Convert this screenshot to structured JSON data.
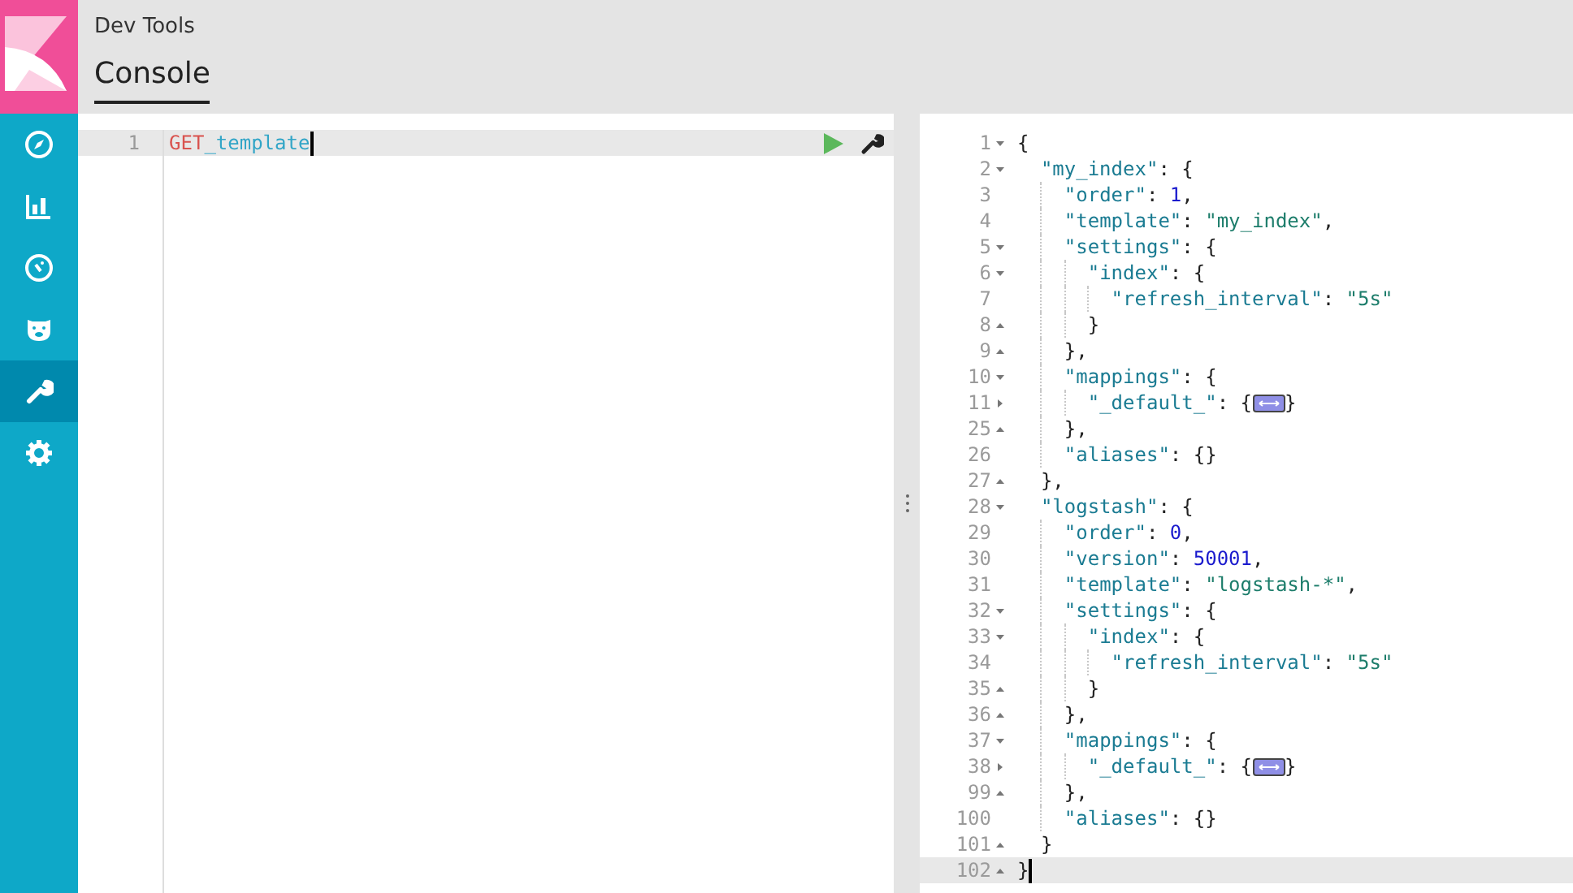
{
  "app": {
    "title": "Dev Tools"
  },
  "nav": [
    {
      "kind": "compass",
      "selected": false
    },
    {
      "kind": "chart",
      "selected": false
    },
    {
      "kind": "gauge",
      "selected": false
    },
    {
      "kind": "bear",
      "selected": false
    },
    {
      "kind": "wrench",
      "selected": true
    },
    {
      "kind": "gear",
      "selected": false
    }
  ],
  "tabs": [
    {
      "label": "Console",
      "selected": true
    }
  ],
  "request": {
    "lines": [
      {
        "number": "1",
        "active": true,
        "tokens": [
          {
            "kind": "method",
            "text": "GET"
          },
          {
            "kind": "url",
            "text": "_template"
          }
        ]
      }
    ]
  },
  "response": {
    "lines": [
      {
        "number": "1",
        "kind": "opener",
        "active": false,
        "tokens": [
          {
            "kind": "punct",
            "text": "{"
          }
        ],
        "children": [
          {
            "number": "2",
            "kind": "opener",
            "active": false,
            "tokens": [
              {
                "kind": "key",
                "text": "\"my_index\""
              },
              {
                "kind": "punct",
                "text": ": {"
              }
            ],
            "children": [
              {
                "number": "3",
                "active": false,
                "tokens": [
                  {
                    "kind": "key",
                    "text": "\"order\""
                  },
                  {
                    "kind": "punct",
                    "text": ": "
                  },
                  {
                    "kind": "number",
                    "text": "1"
                  },
                  {
                    "kind": "punct",
                    "text": ","
                  }
                ]
              },
              {
                "number": "4",
                "active": false,
                "tokens": [
                  {
                    "kind": "key",
                    "text": "\"template\""
                  },
                  {
                    "kind": "punct",
                    "text": ": "
                  },
                  {
                    "kind": "string",
                    "text": "\"my_index\""
                  },
                  {
                    "kind": "punct",
                    "text": ","
                  }
                ]
              },
              {
                "number": "5",
                "kind": "opener",
                "active": false,
                "tokens": [
                  {
                    "kind": "key",
                    "text": "\"settings\""
                  },
                  {
                    "kind": "punct",
                    "text": ": {"
                  }
                ],
                "children": [
                  {
                    "number": "6",
                    "kind": "opener",
                    "active": false,
                    "tokens": [
                      {
                        "kind": "key",
                        "text": "\"index\""
                      },
                      {
                        "kind": "punct",
                        "text": ": {"
                      }
                    ],
                    "children": [
                      {
                        "number": "7",
                        "active": false,
                        "tokens": [
                          {
                            "kind": "key",
                            "text": "\"refresh_interval\""
                          },
                          {
                            "kind": "punct",
                            "text": ": "
                          },
                          {
                            "kind": "string",
                            "text": "\"5s\""
                          }
                        ]
                      }
                    ]
                  },
                  {
                    "number": "8",
                    "kind": "closer",
                    "active": false,
                    "tokens": [
                      {
                        "kind": "punct",
                        "text": "}"
                      }
                    ]
                  }
                ]
              },
              {
                "number": "9",
                "kind": "closer",
                "active": false,
                "tokens": [
                  {
                    "kind": "punct",
                    "text": "},"
                  }
                ]
              },
              {
                "number": "10",
                "kind": "opener",
                "active": false,
                "tokens": [
                  {
                    "kind": "key",
                    "text": "\"mappings\""
                  },
                  {
                    "kind": "punct",
                    "text": ": {"
                  }
                ],
                "children": [
                  {
                    "number": "11",
                    "kind": "collapsed",
                    "active": false,
                    "tokens": [
                      {
                        "kind": "key",
                        "text": "\"_default_\""
                      },
                      {
                        "kind": "punct",
                        "text": ": {"
                      },
                      {
                        "kind": "folded"
                      },
                      {
                        "kind": "punct",
                        "text": "}"
                      }
                    ]
                  }
                ]
              },
              {
                "number": "25",
                "kind": "closer",
                "active": false,
                "tokens": [
                  {
                    "kind": "punct",
                    "text": "},"
                  }
                ]
              },
              {
                "number": "26",
                "active": false,
                "tokens": [
                  {
                    "kind": "key",
                    "text": "\"aliases\""
                  },
                  {
                    "kind": "punct",
                    "text": ": {}"
                  }
                ]
              }
            ]
          },
          {
            "number": "27",
            "kind": "closer",
            "active": false,
            "tokens": [
              {
                "kind": "punct",
                "text": "},"
              }
            ]
          },
          {
            "number": "28",
            "kind": "opener",
            "active": false,
            "tokens": [
              {
                "kind": "key",
                "text": "\"logstash\""
              },
              {
                "kind": "punct",
                "text": ": {"
              }
            ],
            "children": [
              {
                "number": "29",
                "active": false,
                "tokens": [
                  {
                    "kind": "key",
                    "text": "\"order\""
                  },
                  {
                    "kind": "punct",
                    "text": ": "
                  },
                  {
                    "kind": "number",
                    "text": "0"
                  },
                  {
                    "kind": "punct",
                    "text": ","
                  }
                ]
              },
              {
                "number": "30",
                "active": false,
                "tokens": [
                  {
                    "kind": "key",
                    "text": "\"version\""
                  },
                  {
                    "kind": "punct",
                    "text": ": "
                  },
                  {
                    "kind": "number",
                    "text": "50001"
                  },
                  {
                    "kind": "punct",
                    "text": ","
                  }
                ]
              },
              {
                "number": "31",
                "active": false,
                "tokens": [
                  {
                    "kind": "key",
                    "text": "\"template\""
                  },
                  {
                    "kind": "punct",
                    "text": ": "
                  },
                  {
                    "kind": "string",
                    "text": "\"logstash-*\""
                  },
                  {
                    "kind": "punct",
                    "text": ","
                  }
                ]
              },
              {
                "number": "32",
                "kind": "opener",
                "active": false,
                "tokens": [
                  {
                    "kind": "key",
                    "text": "\"settings\""
                  },
                  {
                    "kind": "punct",
                    "text": ": {"
                  }
                ],
                "children": [
                  {
                    "number": "33",
                    "kind": "opener",
                    "active": false,
                    "tokens": [
                      {
                        "kind": "key",
                        "text": "\"index\""
                      },
                      {
                        "kind": "punct",
                        "text": ": {"
                      }
                    ],
                    "children": [
                      {
                        "number": "34",
                        "active": false,
                        "tokens": [
                          {
                            "kind": "key",
                            "text": "\"refresh_interval\""
                          },
                          {
                            "kind": "punct",
                            "text": ": "
                          },
                          {
                            "kind": "string",
                            "text": "\"5s\""
                          }
                        ]
                      }
                    ]
                  },
                  {
                    "number": "35",
                    "kind": "closer",
                    "active": false,
                    "tokens": [
                      {
                        "kind": "punct",
                        "text": "}"
                      }
                    ]
                  }
                ]
              },
              {
                "number": "36",
                "kind": "closer",
                "active": false,
                "tokens": [
                  {
                    "kind": "punct",
                    "text": "},"
                  }
                ]
              },
              {
                "number": "37",
                "kind": "opener",
                "active": false,
                "tokens": [
                  {
                    "kind": "key",
                    "text": "\"mappings\""
                  },
                  {
                    "kind": "punct",
                    "text": ": {"
                  }
                ],
                "children": [
                  {
                    "number": "38",
                    "kind": "collapsed",
                    "active": false,
                    "tokens": [
                      {
                        "kind": "key",
                        "text": "\"_default_\""
                      },
                      {
                        "kind": "punct",
                        "text": ": {"
                      },
                      {
                        "kind": "folded"
                      },
                      {
                        "kind": "punct",
                        "text": "}"
                      }
                    ]
                  }
                ]
              },
              {
                "number": "99",
                "kind": "closer",
                "active": false,
                "tokens": [
                  {
                    "kind": "punct",
                    "text": "},"
                  }
                ]
              },
              {
                "number": "100",
                "active": false,
                "tokens": [
                  {
                    "kind": "key",
                    "text": "\"aliases\""
                  },
                  {
                    "kind": "punct",
                    "text": ": {}"
                  }
                ]
              }
            ]
          },
          {
            "number": "101",
            "kind": "closer",
            "active": false,
            "tokens": [
              {
                "kind": "punct",
                "text": "}"
              }
            ]
          }
        ]
      },
      {
        "number": "102",
        "kind": "closer",
        "active": true,
        "tokens": [
          {
            "kind": "punct",
            "text": "}"
          }
        ]
      }
    ]
  }
}
